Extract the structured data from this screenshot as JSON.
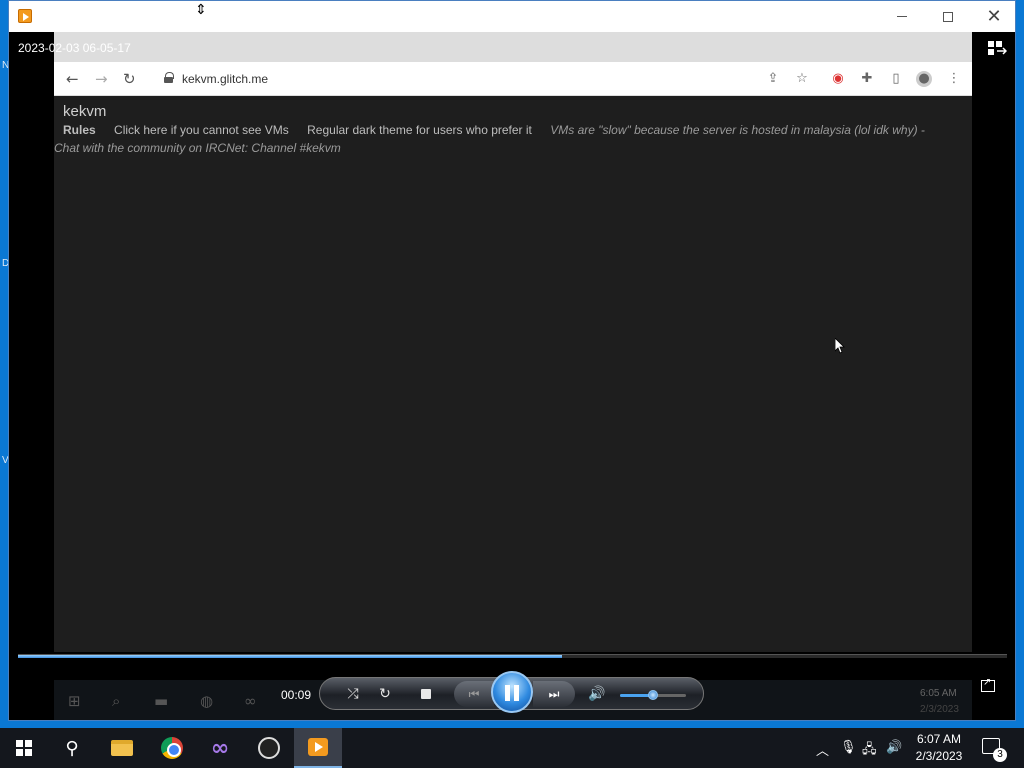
{
  "video": {
    "timestamp": "2023-02-03 06-05-17"
  },
  "browser": {
    "url": "kekvm.glitch.me",
    "site_title": "kekvm",
    "nav": {
      "rules": "Rules",
      "cannot_see": "Click here if you cannot see VMs",
      "dark_theme": "Regular dark theme for users who prefer it",
      "slow_note": "VMs are \"slow\" because the server is hosted in malaysia (lol idk why) -"
    },
    "chat_line": "Chat with the community on IRCNet: Channel #kekvm"
  },
  "player": {
    "elapsed": "00:09",
    "progress": 0.55,
    "volume": 0.5
  },
  "ghost_taskbar": {
    "time": "6:05 AM",
    "date": "2/3/2023"
  },
  "taskbar": {
    "time": "6:07 AM",
    "date": "2/3/2023",
    "notification_count": "3",
    "apps": [
      "start",
      "search",
      "file-explorer",
      "chrome",
      "visual-studio",
      "obs",
      "windows-media-player"
    ]
  }
}
